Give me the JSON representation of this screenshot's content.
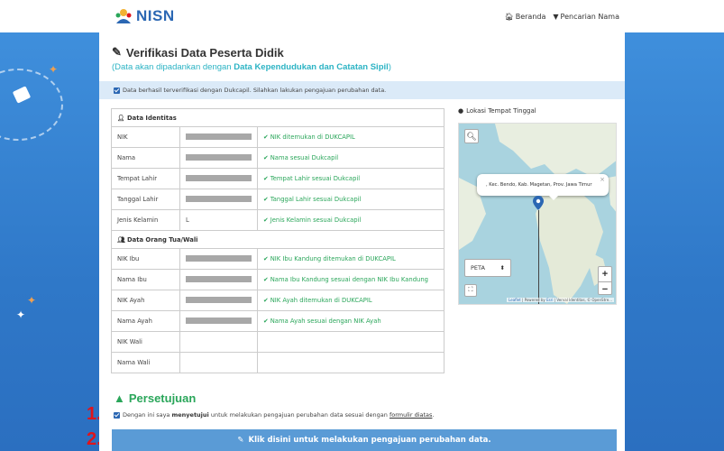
{
  "brand": {
    "logo_text": "NISN"
  },
  "topnav": {
    "home": "Beranda",
    "search": "Pencarian Nama"
  },
  "page": {
    "title": "Verifikasi Data Peserta Didik",
    "subtitle_prefix": "(Data akan dipadankan dengan ",
    "subtitle_bold": "Data Kependudukan dan Catatan Sipil",
    "subtitle_suffix": ")"
  },
  "alert": {
    "text": "Data berhasil terverifikasi dengan Dukcapil. Silahkan lakukan pengajuan perubahan data."
  },
  "identity": {
    "header": "Data Identitas",
    "rows": [
      {
        "label": "NIK",
        "value": "",
        "masked": true,
        "status": "NIK ditemukan di DUKCAPIL"
      },
      {
        "label": "Nama",
        "value": "",
        "masked": true,
        "status": "Nama sesuai Dukcapil"
      },
      {
        "label": "Tempat Lahir",
        "value": "",
        "masked": true,
        "status": "Tempat Lahir sesuai Dukcapil"
      },
      {
        "label": "Tanggal Lahir",
        "value": "",
        "masked": true,
        "status": "Tanggal Lahir sesuai Dukcapil"
      },
      {
        "label": "Jenis Kelamin",
        "value": "L",
        "masked": false,
        "status": "Jenis Kelamin sesuai Dukcapil"
      }
    ]
  },
  "parents": {
    "header": "Data Orang Tua/Wali",
    "rows": [
      {
        "label": "NIK Ibu",
        "value": "",
        "masked": true,
        "status": "NIK Ibu Kandung ditemukan di DUKCAPIL"
      },
      {
        "label": "Nama Ibu",
        "value": "",
        "masked": true,
        "status": "Nama Ibu Kandung sesuai dengan NIK Ibu Kandung"
      },
      {
        "label": "NIK Ayah",
        "value": "",
        "masked": true,
        "status": "NIK Ayah ditemukan di DUKCAPIL"
      },
      {
        "label": "Nama Ayah",
        "value": "",
        "masked": true,
        "status": "Nama Ayah sesuai dengan NIK Ayah"
      },
      {
        "label": "NIK Wali",
        "value": "",
        "masked": false,
        "status": ""
      },
      {
        "label": "Nama Wali",
        "value": "",
        "masked": false,
        "status": ""
      }
    ]
  },
  "map": {
    "label": "Lokasi Tempat Tinggal",
    "popup": ", Kec. Bendo, Kab. Magetan, Prov. Jawa Timur",
    "layer_select": "PETA",
    "zoom_in": "+",
    "zoom_out": "−",
    "attribution_link1": "Leaflet",
    "attribution_mid": " | Powered by ",
    "attribution_link2": "Esri",
    "attribution_end": " | Verval Identitas, © OpenStre..."
  },
  "consent": {
    "title": "Persetujuan",
    "text_prefix": "Dengan ini saya ",
    "text_bold": "menyetujui",
    "text_mid": " untuk melakukan pengajuan perubahan data sesuai dengan ",
    "text_link": "formulir diatas",
    "text_suffix": ".",
    "checked": true
  },
  "submit": {
    "label": "Klik disini untuk melakukan pengajuan perubahan data."
  },
  "annotations": {
    "step1": "1.",
    "step2": "2."
  },
  "colors": {
    "primary": "#2b67b3",
    "success": "#2aa65a",
    "accent": "#2bb3c4",
    "button": "#5a9bd6",
    "marker": "#e0141b"
  }
}
